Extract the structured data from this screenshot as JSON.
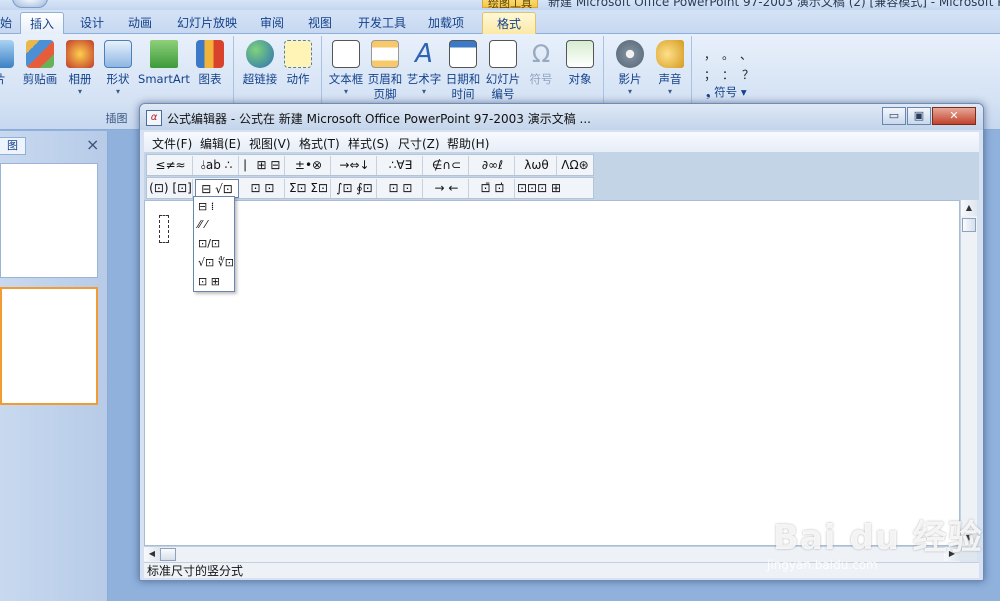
{
  "ppt": {
    "title": "新建 Microsoft Office PowerPoint 97-2003 演示文稿 (2) [兼容模式] - Microsoft PowerPoint",
    "context_group": "绘图工具",
    "tabs": [
      "始",
      "插入",
      "设计",
      "动画",
      "幻灯片放映",
      "审阅",
      "视图",
      "开发工具",
      "加载项",
      "格式"
    ],
    "ribbon": {
      "buttons": [
        "片",
        "剪贴画",
        "相册",
        "形状",
        "SmartArt",
        "图表",
        "超链接",
        "动作",
        "文本框",
        "页眉和\n页脚",
        "艺术字",
        "日期和\n时间",
        "幻灯片\n编号",
        "符号",
        "对象",
        "影片",
        "声音"
      ],
      "group_label": "插图",
      "symbol_marks": [
        "，",
        "。",
        "、",
        "；",
        "：",
        "？"
      ],
      "symbol_button": "符号"
    },
    "panel_close": "×",
    "panel_tab": "图"
  },
  "eq": {
    "title": "公式编辑器 - 公式在 新建 Microsoft Office PowerPoint 97-2003 演示文稿 ...",
    "app_icon": "α",
    "controls": {
      "minimize": "▭",
      "maximize": "▣",
      "close": "✕"
    },
    "menus": [
      "文件(F)",
      "编辑(E)",
      "视图(V)",
      "格式(T)",
      "样式(S)",
      "尺寸(Z)",
      "帮助(H)"
    ],
    "palette_row1": [
      "≤≠≈",
      "⫰ab ∴",
      "⎸⊞ ⊟",
      "±•⊗",
      "→⇔↓",
      "∴∀∃",
      "∉∩⊂",
      "∂∞ℓ",
      "λωθ",
      "ΛΩ⊛"
    ],
    "palette_row2": [
      "(⊡) [⊡]",
      "⊟ √⊡",
      "⊡ ⊡",
      "Σ⊡ Σ⊡",
      "∫⊡ ∮⊡",
      "⊡ ⊡",
      "→ ←",
      "⊡̄ ⊡̇",
      "⊡⊡⊡ ⊞"
    ],
    "frac_menu": [
      "⊟  ⁞",
      "⁄⁄  ⁄",
      "⊡/⊡",
      "√⊡ ∜⊡",
      "⊡  ⊞"
    ],
    "status": "标准尺寸的竖分式"
  },
  "watermark": {
    "main": "Bai du 经验",
    "sub": "jingyan.baidu.com"
  },
  "colors": {
    "accent": "#15428b",
    "window_bg": "#d6e2f1",
    "selection_border": "#f29b33"
  }
}
